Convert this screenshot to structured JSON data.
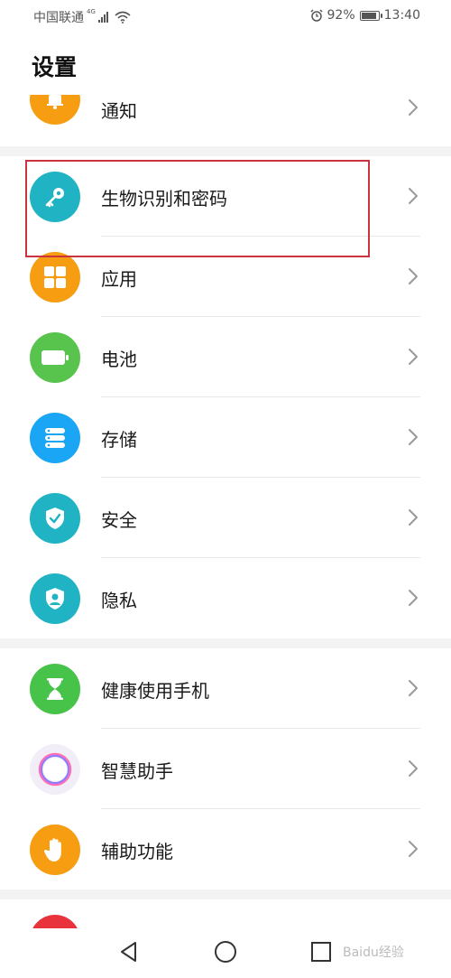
{
  "status": {
    "carrier": "中国联通",
    "network": "4G",
    "battery": "92%",
    "battery_level": 0.92,
    "time": "13:40"
  },
  "title": "设置",
  "items": [
    {
      "label": "通知",
      "icon": "bell-icon",
      "color": "#f79d11"
    },
    {
      "label": "生物识别和密码",
      "icon": "key-icon",
      "color": "#1fb3c3"
    },
    {
      "label": "应用",
      "icon": "grid-icon",
      "color": "#f79d11"
    },
    {
      "label": "电池",
      "icon": "battery-icon",
      "color": "#58c44e"
    },
    {
      "label": "存储",
      "icon": "storage-icon",
      "color": "#1aa5f5"
    },
    {
      "label": "安全",
      "icon": "shield-check-icon",
      "color": "#1fb3c3"
    },
    {
      "label": "隐私",
      "icon": "privacy-icon",
      "color": "#1fb3c3"
    },
    {
      "label": "健康使用手机",
      "icon": "hourglass-icon",
      "color": "#47c34a"
    },
    {
      "label": "智慧助手",
      "icon": "assistant-icon",
      "color": "#9b6bf5"
    },
    {
      "label": "辅助功能",
      "icon": "hand-icon",
      "color": "#f79d11"
    }
  ],
  "highlight_color": "#c9343e",
  "watermark": "Baidu经验"
}
